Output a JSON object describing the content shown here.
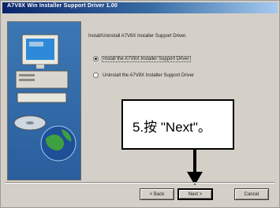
{
  "window": {
    "title": "A7V8X Win Installer Support Driver 1.00"
  },
  "dialog": {
    "prompt": "Install/Uninstall A7V8X Installer Support Driver.",
    "options": [
      {
        "label": "Install the A7V8X Installer Support Driver",
        "checked": true
      },
      {
        "label": "Uninstall the A7V8X Installer Support Driver",
        "checked": false
      }
    ]
  },
  "callout": {
    "text": "5.按 \"Next\"。"
  },
  "buttons": {
    "back": "< Back",
    "next": "Next >",
    "cancel": "Cancel"
  },
  "colors": {
    "titlebar_start": "#0a246a",
    "titlebar_end": "#a6caf0",
    "panel": "#3c78b4",
    "dialog_bg": "#d4d0c8"
  }
}
